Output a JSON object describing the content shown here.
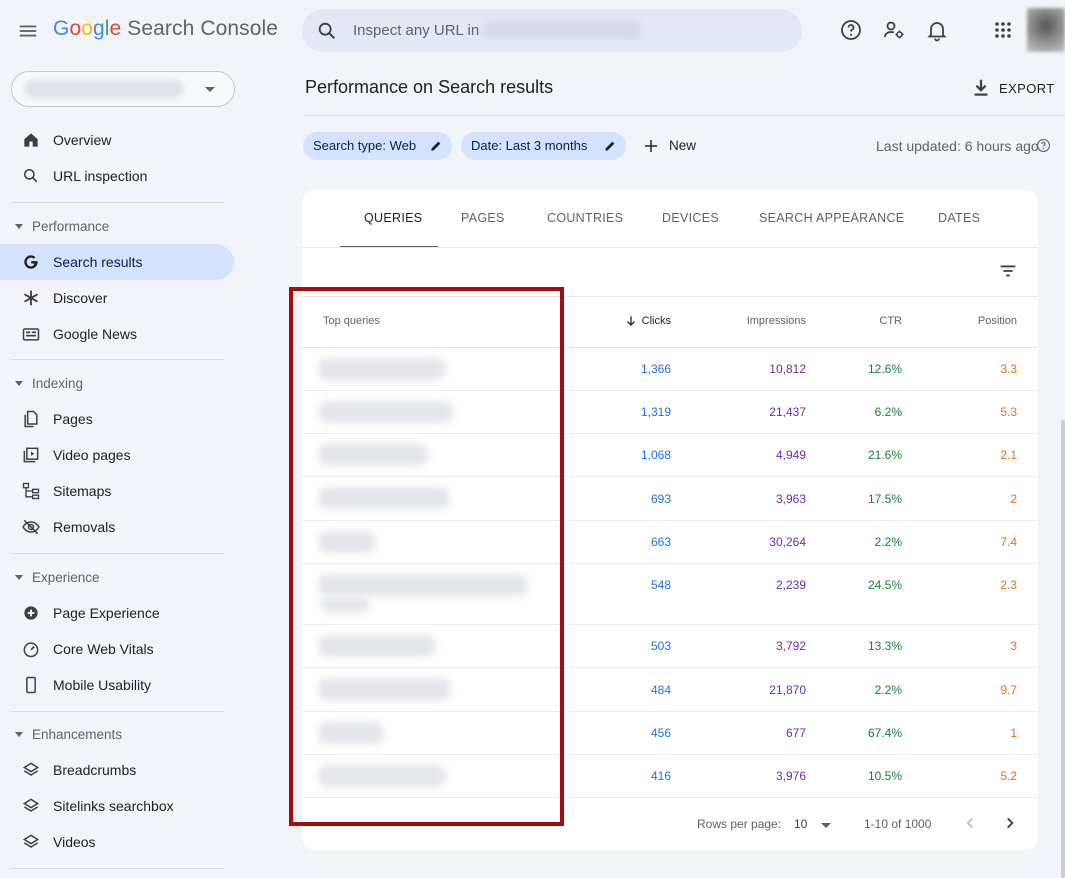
{
  "header": {
    "logo_google": [
      "G",
      "o",
      "o",
      "g",
      "l",
      "e"
    ],
    "logo_product": "Search Console",
    "search_placeholder": "Inspect any URL in"
  },
  "sidebar": {
    "items_top": [
      {
        "label": "Overview",
        "icon": "home-icon"
      },
      {
        "label": "URL inspection",
        "icon": "search-icon"
      }
    ],
    "sections": [
      {
        "title": "Performance",
        "items": [
          {
            "label": "Search results",
            "icon": "google-g-icon",
            "active": true
          },
          {
            "label": "Discover",
            "icon": "asterisk-icon"
          },
          {
            "label": "Google News",
            "icon": "news-icon"
          }
        ]
      },
      {
        "title": "Indexing",
        "items": [
          {
            "label": "Pages",
            "icon": "pages-icon"
          },
          {
            "label": "Video pages",
            "icon": "video-pages-icon"
          },
          {
            "label": "Sitemaps",
            "icon": "sitemap-icon"
          },
          {
            "label": "Removals",
            "icon": "eye-off-icon"
          }
        ]
      },
      {
        "title": "Experience",
        "items": [
          {
            "label": "Page Experience",
            "icon": "plus-circle-icon"
          },
          {
            "label": "Core Web Vitals",
            "icon": "gauge-icon"
          },
          {
            "label": "Mobile Usability",
            "icon": "phone-icon"
          }
        ]
      },
      {
        "title": "Enhancements",
        "items": [
          {
            "label": "Breadcrumbs",
            "icon": "layers-icon"
          },
          {
            "label": "Sitelinks searchbox",
            "icon": "layers-icon"
          },
          {
            "label": "Videos",
            "icon": "layers-icon"
          }
        ]
      }
    ]
  },
  "main": {
    "title": "Performance on Search results",
    "export_label": "EXPORT",
    "filters": [
      {
        "label": "Search type: Web"
      },
      {
        "label": "Date: Last 3 months"
      }
    ],
    "new_label": "New",
    "last_updated": "Last updated: 6 hours ago"
  },
  "tabs": [
    "QUERIES",
    "PAGES",
    "COUNTRIES",
    "DEVICES",
    "SEARCH APPEARANCE",
    "DATES"
  ],
  "active_tab": "QUERIES",
  "table": {
    "headers": {
      "query": "Top queries",
      "clicks": "Clicks",
      "impressions": "Impressions",
      "ctr": "CTR",
      "position": "Position"
    },
    "sort_column": "Clicks",
    "rows": [
      {
        "clicks": "1,366",
        "impressions": "10,812",
        "ctr": "12.6%",
        "position": "3.3"
      },
      {
        "clicks": "1,319",
        "impressions": "21,437",
        "ctr": "6.2%",
        "position": "5.3"
      },
      {
        "clicks": "1,068",
        "impressions": "4,949",
        "ctr": "21.6%",
        "position": "2.1"
      },
      {
        "clicks": "693",
        "impressions": "3,963",
        "ctr": "17.5%",
        "position": "2"
      },
      {
        "clicks": "663",
        "impressions": "30,264",
        "ctr": "2.2%",
        "position": "7.4"
      },
      {
        "clicks": "548",
        "impressions": "2,239",
        "ctr": "24.5%",
        "position": "2.3"
      },
      {
        "clicks": "503",
        "impressions": "3,792",
        "ctr": "13.3%",
        "position": "3"
      },
      {
        "clicks": "484",
        "impressions": "21,870",
        "ctr": "2.2%",
        "position": "9.7"
      },
      {
        "clicks": "456",
        "impressions": "677",
        "ctr": "67.4%",
        "position": "1"
      },
      {
        "clicks": "416",
        "impressions": "3,976",
        "ctr": "10.5%",
        "position": "5.2"
      }
    ]
  },
  "pagination": {
    "rows_per_page_label": "Rows per page:",
    "rows_per_page": "10",
    "range": "1-10 of 1000"
  },
  "colors": {
    "clicks": "#1a73e8",
    "impressions": "#6f2da8",
    "ctr": "#188038",
    "position": "#e8710a",
    "highlight": "#a30d11",
    "chip": "#d3e3fd"
  }
}
